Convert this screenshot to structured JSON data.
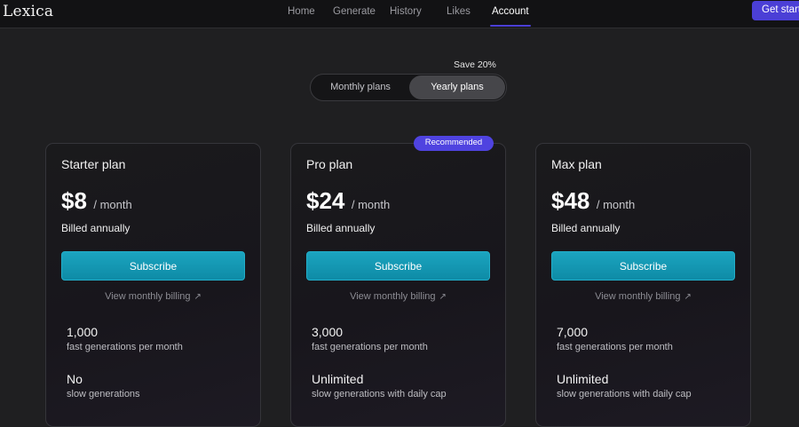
{
  "header": {
    "logo": "Lexica",
    "nav": [
      "Home",
      "Generate",
      "History",
      "Likes",
      "Account"
    ],
    "active_nav": "Account",
    "cta_label": "Get started"
  },
  "billing_toggle": {
    "save_label": "Save 20%",
    "monthly_label": "Monthly plans",
    "yearly_label": "Yearly plans",
    "selected": "Yearly plans"
  },
  "colors": {
    "accent_purple": "#4f43e0",
    "subscribe_teal": "#1597b3",
    "background": "#1f1f21"
  },
  "plans": [
    {
      "name": "Starter plan",
      "price": "$8",
      "period": "/ month",
      "billing": "Billed annually",
      "cta": "Subscribe",
      "link": "View monthly billing",
      "link_icon": "external-arrow-icon",
      "features": [
        {
          "value": "1,000",
          "desc": "fast generations per month"
        },
        {
          "value": "No",
          "desc": "slow generations"
        }
      ]
    },
    {
      "name": "Pro plan",
      "badge": "Recommended",
      "price": "$24",
      "period": "/ month",
      "billing": "Billed annually",
      "cta": "Subscribe",
      "link": "View monthly billing",
      "link_icon": "external-arrow-icon",
      "features": [
        {
          "value": "3,000",
          "desc": "fast generations per month"
        },
        {
          "value": "Unlimited",
          "desc": "slow generations with daily cap"
        }
      ]
    },
    {
      "name": "Max plan",
      "price": "$48",
      "period": "/ month",
      "billing": "Billed annually",
      "cta": "Subscribe",
      "link": "View monthly billing",
      "link_icon": "external-arrow-icon",
      "features": [
        {
          "value": "7,000",
          "desc": "fast generations per month"
        },
        {
          "value": "Unlimited",
          "desc": "slow generations with daily cap"
        }
      ]
    }
  ]
}
